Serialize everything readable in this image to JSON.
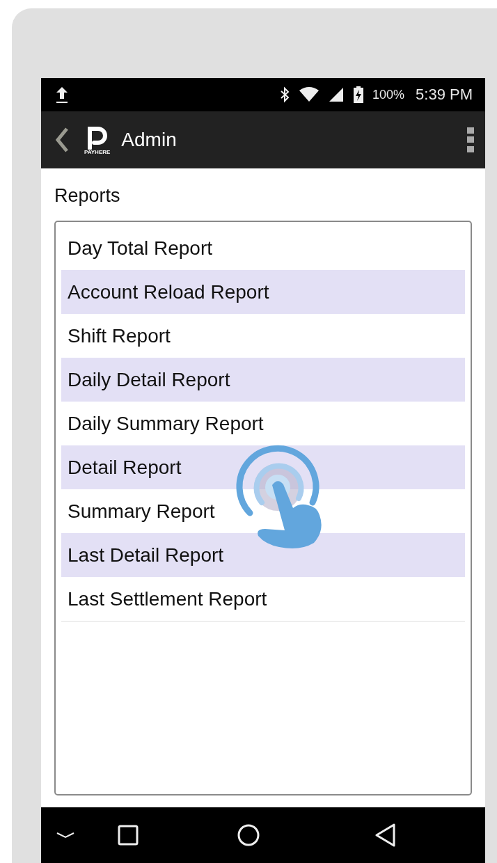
{
  "status_bar": {
    "battery": "100%",
    "time": "5:39 PM"
  },
  "app_bar": {
    "logo_text": "PAYHERE",
    "title": "Admin"
  },
  "section_title": "Reports",
  "reports": [
    {
      "label": "Day Total Report"
    },
    {
      "label": "Account Reload Report"
    },
    {
      "label": "Shift Report"
    },
    {
      "label": "Daily Detail Report"
    },
    {
      "label": "Daily Summary Report"
    },
    {
      "label": "Detail Report"
    },
    {
      "label": "Summary Report"
    },
    {
      "label": "Last Detail Report"
    },
    {
      "label": "Last Settlement Report"
    }
  ]
}
